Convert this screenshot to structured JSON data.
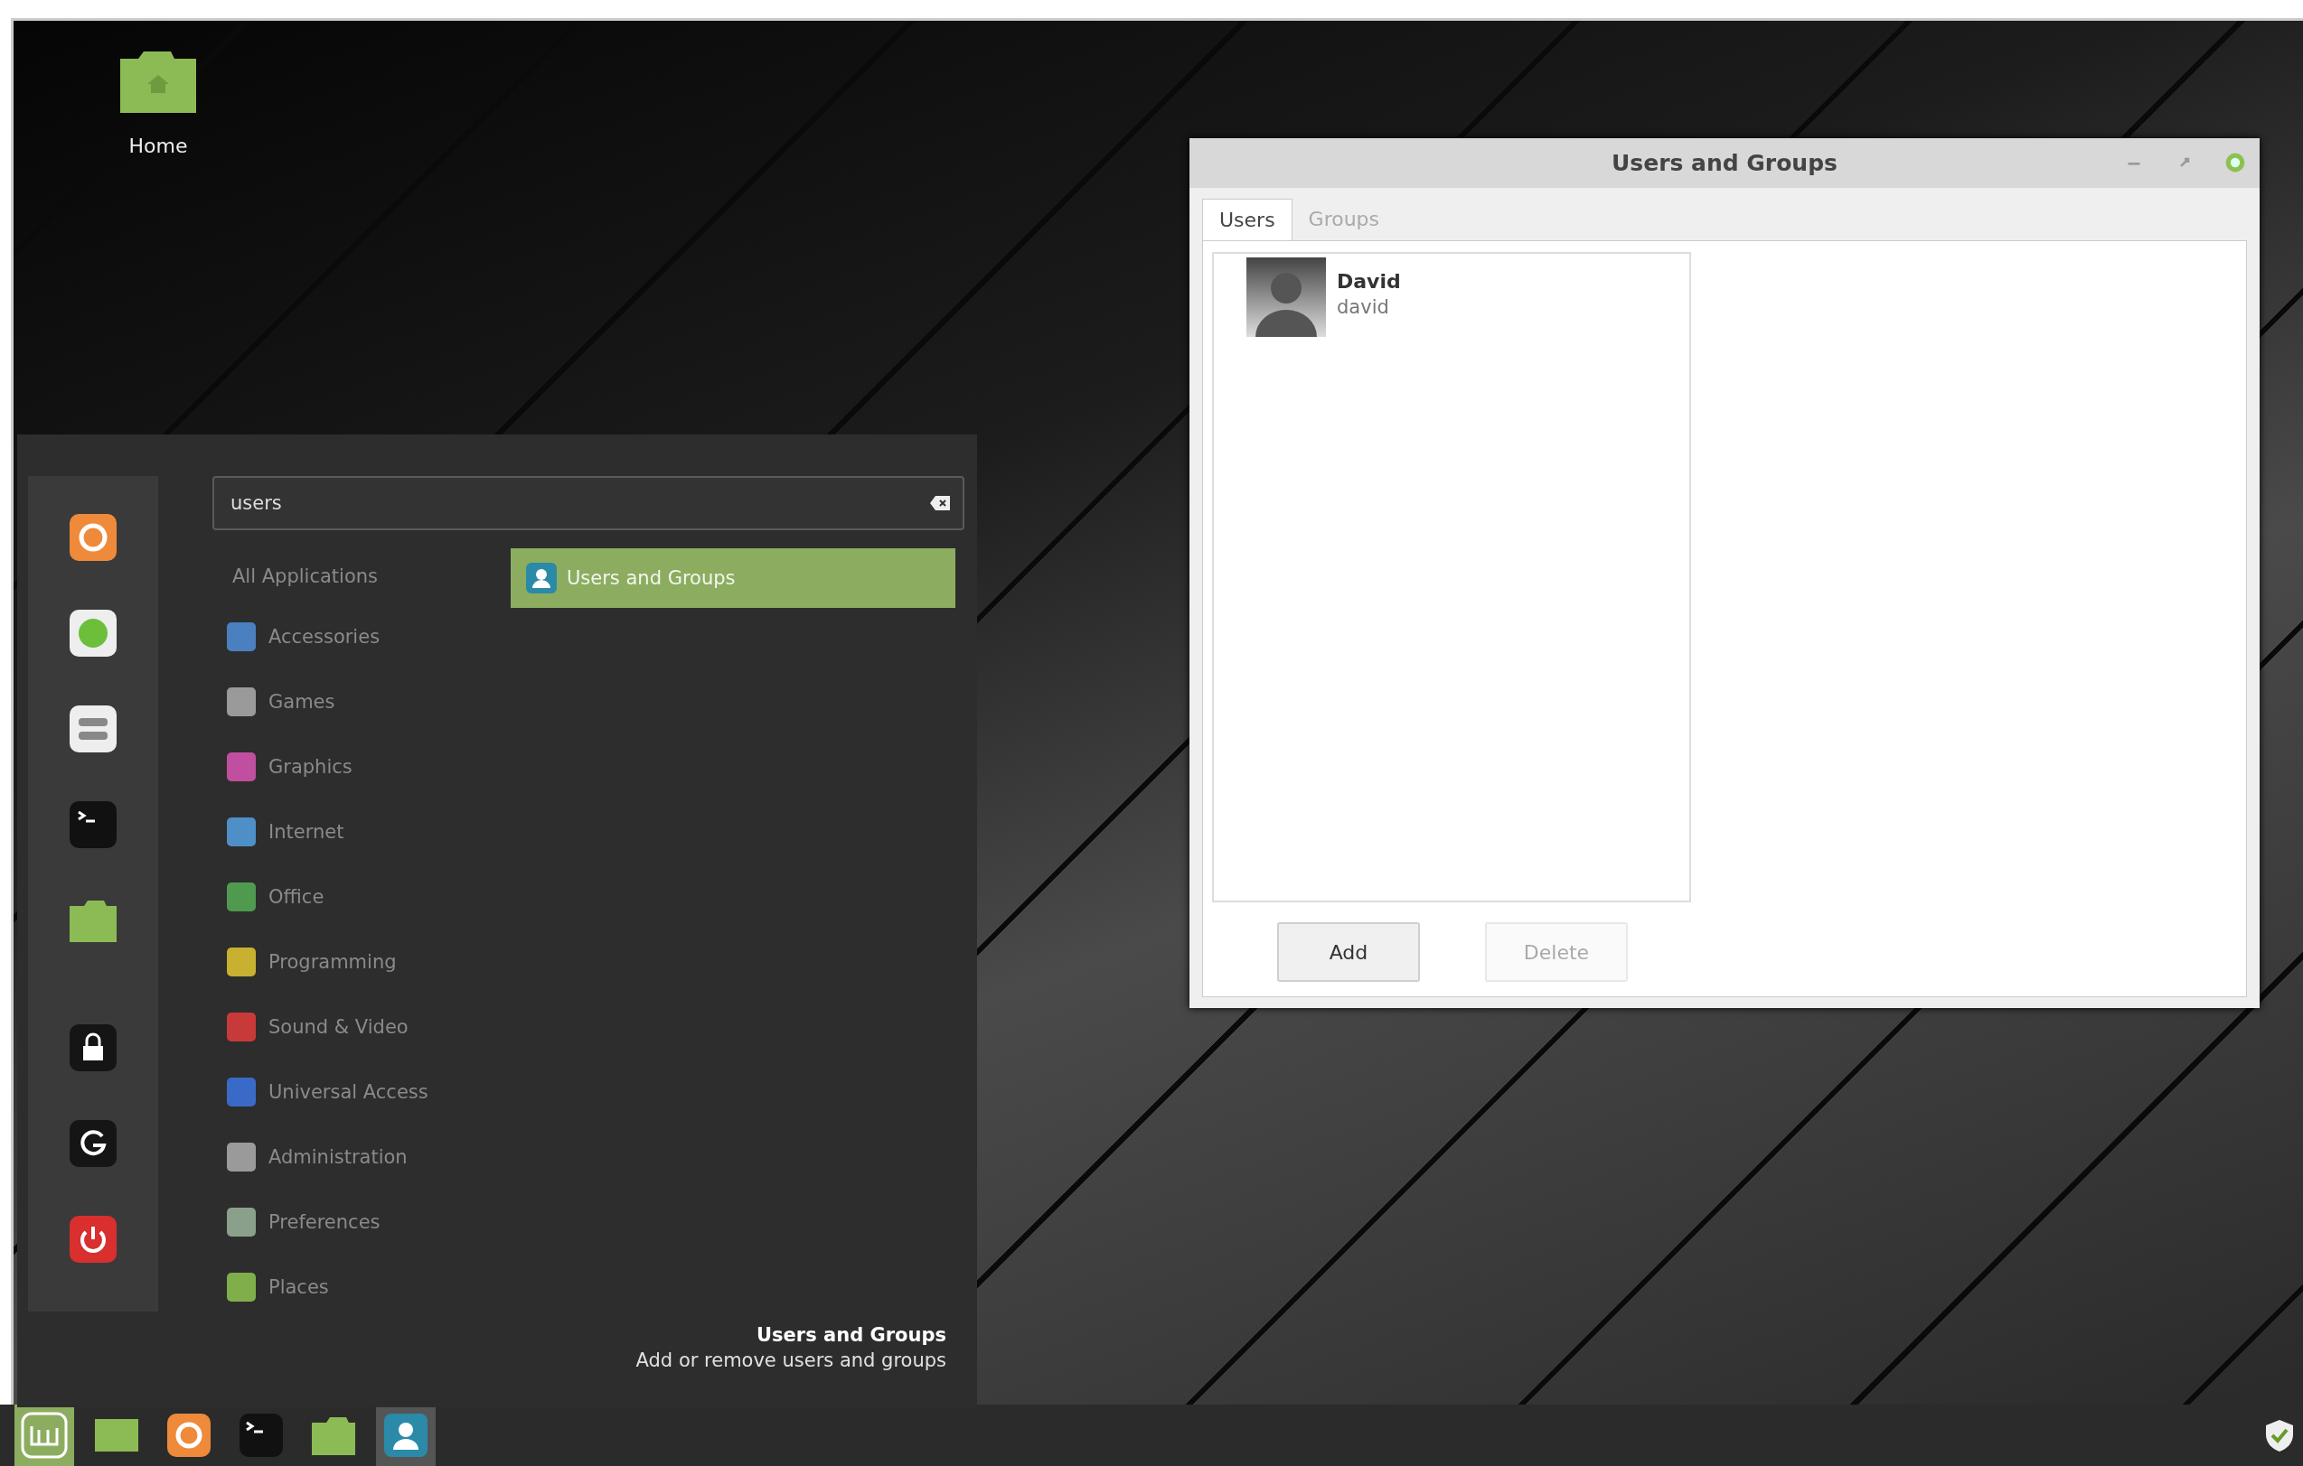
{
  "desktop": {
    "icons": [
      {
        "label": "Home"
      }
    ]
  },
  "menu": {
    "search": {
      "value": "users"
    },
    "categories": [
      {
        "label": "All Applications",
        "kind": "all",
        "selected": false
      },
      {
        "label": "Accessories",
        "kind": "category",
        "selected": false
      },
      {
        "label": "Games",
        "kind": "category",
        "selected": false
      },
      {
        "label": "Graphics",
        "kind": "category",
        "selected": false
      },
      {
        "label": "Internet",
        "kind": "category",
        "selected": false
      },
      {
        "label": "Office",
        "kind": "category",
        "selected": false
      },
      {
        "label": "Programming",
        "kind": "category",
        "selected": false
      },
      {
        "label": "Sound & Video",
        "kind": "category",
        "selected": false
      },
      {
        "label": "Universal Access",
        "kind": "category",
        "selected": false
      },
      {
        "label": "Administration",
        "kind": "category",
        "selected": false
      },
      {
        "label": "Preferences",
        "kind": "category",
        "selected": false
      },
      {
        "label": "Places",
        "kind": "category",
        "selected": false
      }
    ],
    "results": [
      {
        "label": "Users and Groups",
        "selected": true
      }
    ],
    "description": {
      "title": "Users and Groups",
      "text": "Add or remove users and groups"
    }
  },
  "window": {
    "title": "Users and Groups",
    "tabs": [
      {
        "label": "Users",
        "selected": true
      },
      {
        "label": "Groups",
        "selected": false
      }
    ],
    "users": [
      {
        "name": "David",
        "login": "david"
      }
    ],
    "buttons": [
      {
        "label": "Add",
        "disabled": false
      },
      {
        "label": "Delete",
        "disabled": true
      }
    ]
  },
  "taskbar": {
    "items": [
      {
        "active": true
      },
      {
        "active": false
      },
      {
        "active": false
      },
      {
        "active": false
      },
      {
        "active": false
      },
      {
        "active": true
      }
    ]
  }
}
